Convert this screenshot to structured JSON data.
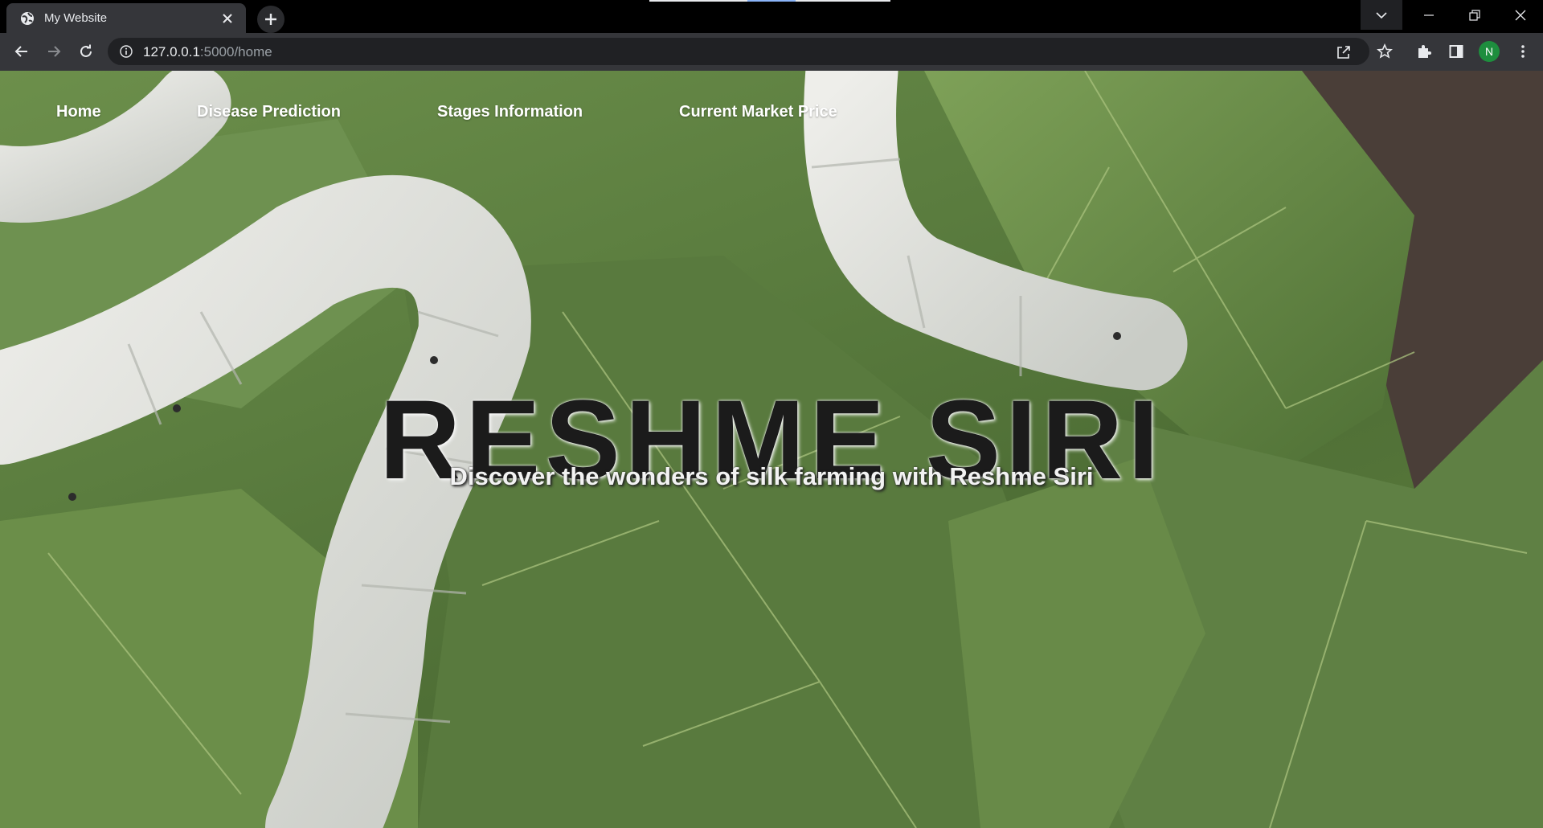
{
  "browser": {
    "tab_title": "My Website",
    "url_host": "127.0.0.1",
    "url_path": ":5000/home",
    "profile_initial": "N",
    "profile_color": "#1e8e3e"
  },
  "site": {
    "nav": [
      {
        "label": "Home"
      },
      {
        "label": "Disease Prediction"
      },
      {
        "label": "Stages Information"
      },
      {
        "label": "Current Market Price"
      }
    ],
    "hero_title": "RESHME SIRI",
    "hero_subtitle": "Discover the wonders of silk farming with Reshme Siri",
    "background_image": "silkworms-on-mulberry-leaves"
  }
}
